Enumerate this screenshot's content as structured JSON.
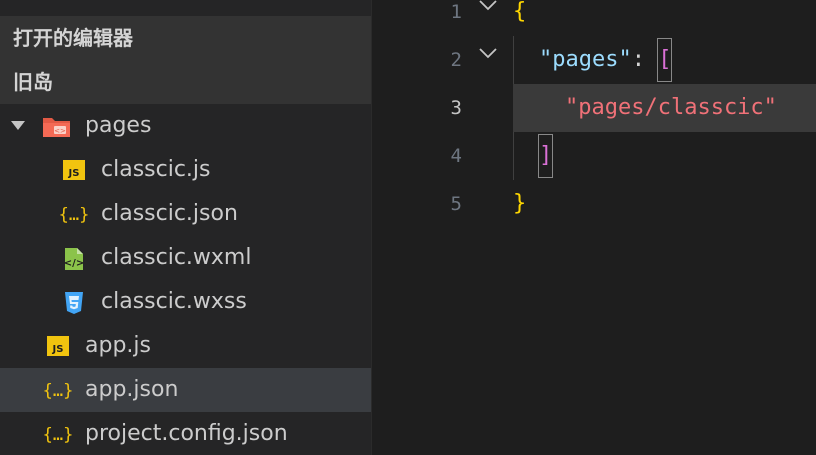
{
  "sidebar": {
    "open_editors_label": "打开的编辑器",
    "project_label": "旧岛",
    "tree": [
      {
        "label": "pages",
        "icon": "folder-pages-icon",
        "expanded": true
      },
      {
        "label": "classcic.js",
        "icon": "js-file-icon"
      },
      {
        "label": "classcic.json",
        "icon": "json-file-icon"
      },
      {
        "label": "classcic.wxml",
        "icon": "wxml-file-icon"
      },
      {
        "label": "classcic.wxss",
        "icon": "css-file-icon"
      },
      {
        "label": "app.js",
        "icon": "js-file-icon"
      },
      {
        "label": "app.json",
        "icon": "json-file-icon",
        "selected": true
      },
      {
        "label": "project.config.json",
        "icon": "json-file-icon"
      }
    ]
  },
  "editor": {
    "lines": [
      {
        "num": "1",
        "brace": "{"
      },
      {
        "num": "2",
        "key": "\"pages\"",
        "colon": ":",
        "bracket": "["
      },
      {
        "num": "3",
        "string": "\"pages/classcic\"",
        "current": true
      },
      {
        "num": "4",
        "bracket": "]"
      },
      {
        "num": "5",
        "brace": "}"
      }
    ]
  },
  "colors": {
    "sidebar_bg": "#252526",
    "header_bg": "#333333",
    "selected_bg": "#3a3d41",
    "editor_bg": "#1e1e1e",
    "brace": "#ffd700",
    "key": "#9cdcfe",
    "bracket": "#da70d6",
    "string": "#f07178"
  }
}
